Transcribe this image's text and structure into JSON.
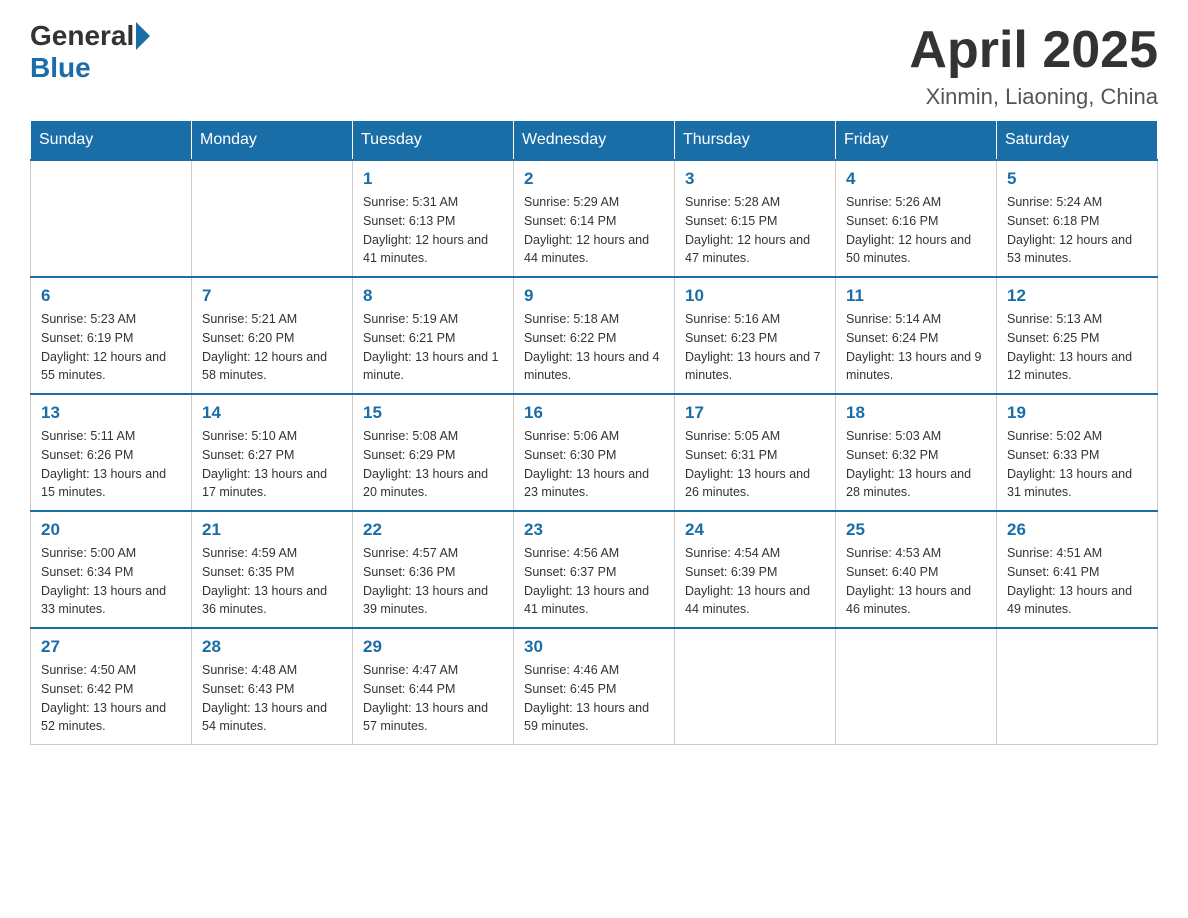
{
  "header": {
    "logo_general": "General",
    "logo_blue": "Blue",
    "month_title": "April 2025",
    "location": "Xinmin, Liaoning, China"
  },
  "weekdays": [
    "Sunday",
    "Monday",
    "Tuesday",
    "Wednesday",
    "Thursday",
    "Friday",
    "Saturday"
  ],
  "weeks": [
    [
      null,
      null,
      {
        "day": 1,
        "sunrise": "5:31 AM",
        "sunset": "6:13 PM",
        "daylight": "12 hours and 41 minutes."
      },
      {
        "day": 2,
        "sunrise": "5:29 AM",
        "sunset": "6:14 PM",
        "daylight": "12 hours and 44 minutes."
      },
      {
        "day": 3,
        "sunrise": "5:28 AM",
        "sunset": "6:15 PM",
        "daylight": "12 hours and 47 minutes."
      },
      {
        "day": 4,
        "sunrise": "5:26 AM",
        "sunset": "6:16 PM",
        "daylight": "12 hours and 50 minutes."
      },
      {
        "day": 5,
        "sunrise": "5:24 AM",
        "sunset": "6:18 PM",
        "daylight": "12 hours and 53 minutes."
      }
    ],
    [
      {
        "day": 6,
        "sunrise": "5:23 AM",
        "sunset": "6:19 PM",
        "daylight": "12 hours and 55 minutes."
      },
      {
        "day": 7,
        "sunrise": "5:21 AM",
        "sunset": "6:20 PM",
        "daylight": "12 hours and 58 minutes."
      },
      {
        "day": 8,
        "sunrise": "5:19 AM",
        "sunset": "6:21 PM",
        "daylight": "13 hours and 1 minute."
      },
      {
        "day": 9,
        "sunrise": "5:18 AM",
        "sunset": "6:22 PM",
        "daylight": "13 hours and 4 minutes."
      },
      {
        "day": 10,
        "sunrise": "5:16 AM",
        "sunset": "6:23 PM",
        "daylight": "13 hours and 7 minutes."
      },
      {
        "day": 11,
        "sunrise": "5:14 AM",
        "sunset": "6:24 PM",
        "daylight": "13 hours and 9 minutes."
      },
      {
        "day": 12,
        "sunrise": "5:13 AM",
        "sunset": "6:25 PM",
        "daylight": "13 hours and 12 minutes."
      }
    ],
    [
      {
        "day": 13,
        "sunrise": "5:11 AM",
        "sunset": "6:26 PM",
        "daylight": "13 hours and 15 minutes."
      },
      {
        "day": 14,
        "sunrise": "5:10 AM",
        "sunset": "6:27 PM",
        "daylight": "13 hours and 17 minutes."
      },
      {
        "day": 15,
        "sunrise": "5:08 AM",
        "sunset": "6:29 PM",
        "daylight": "13 hours and 20 minutes."
      },
      {
        "day": 16,
        "sunrise": "5:06 AM",
        "sunset": "6:30 PM",
        "daylight": "13 hours and 23 minutes."
      },
      {
        "day": 17,
        "sunrise": "5:05 AM",
        "sunset": "6:31 PM",
        "daylight": "13 hours and 26 minutes."
      },
      {
        "day": 18,
        "sunrise": "5:03 AM",
        "sunset": "6:32 PM",
        "daylight": "13 hours and 28 minutes."
      },
      {
        "day": 19,
        "sunrise": "5:02 AM",
        "sunset": "6:33 PM",
        "daylight": "13 hours and 31 minutes."
      }
    ],
    [
      {
        "day": 20,
        "sunrise": "5:00 AM",
        "sunset": "6:34 PM",
        "daylight": "13 hours and 33 minutes."
      },
      {
        "day": 21,
        "sunrise": "4:59 AM",
        "sunset": "6:35 PM",
        "daylight": "13 hours and 36 minutes."
      },
      {
        "day": 22,
        "sunrise": "4:57 AM",
        "sunset": "6:36 PM",
        "daylight": "13 hours and 39 minutes."
      },
      {
        "day": 23,
        "sunrise": "4:56 AM",
        "sunset": "6:37 PM",
        "daylight": "13 hours and 41 minutes."
      },
      {
        "day": 24,
        "sunrise": "4:54 AM",
        "sunset": "6:39 PM",
        "daylight": "13 hours and 44 minutes."
      },
      {
        "day": 25,
        "sunrise": "4:53 AM",
        "sunset": "6:40 PM",
        "daylight": "13 hours and 46 minutes."
      },
      {
        "day": 26,
        "sunrise": "4:51 AM",
        "sunset": "6:41 PM",
        "daylight": "13 hours and 49 minutes."
      }
    ],
    [
      {
        "day": 27,
        "sunrise": "4:50 AM",
        "sunset": "6:42 PM",
        "daylight": "13 hours and 52 minutes."
      },
      {
        "day": 28,
        "sunrise": "4:48 AM",
        "sunset": "6:43 PM",
        "daylight": "13 hours and 54 minutes."
      },
      {
        "day": 29,
        "sunrise": "4:47 AM",
        "sunset": "6:44 PM",
        "daylight": "13 hours and 57 minutes."
      },
      {
        "day": 30,
        "sunrise": "4:46 AM",
        "sunset": "6:45 PM",
        "daylight": "13 hours and 59 minutes."
      },
      null,
      null,
      null
    ]
  ],
  "labels": {
    "sunrise": "Sunrise:",
    "sunset": "Sunset:",
    "daylight": "Daylight:"
  }
}
